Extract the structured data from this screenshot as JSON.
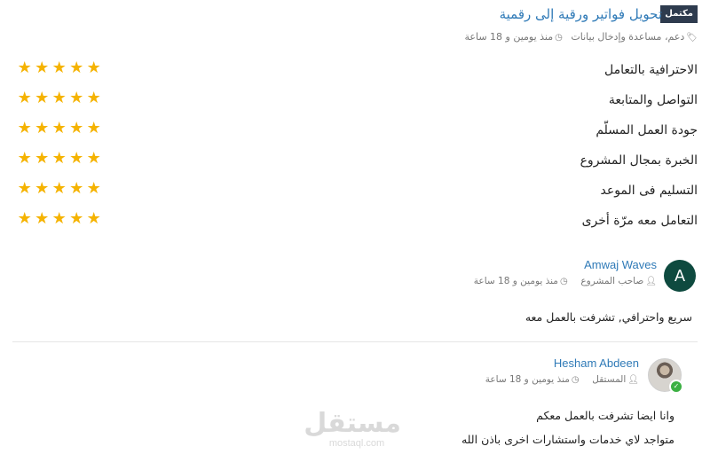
{
  "project": {
    "status_badge": "مكتمل",
    "title": "تحويل فواتير ورقية إلى رقمية",
    "tags": "دعم، مساعدة وإدخال بيانات",
    "time": "منذ يومين و 18 ساعة"
  },
  "ratings": [
    {
      "label": "الاحترافية بالتعامل",
      "stars": 5
    },
    {
      "label": "التواصل والمتابعة",
      "stars": 5
    },
    {
      "label": "جودة العمل المسلّم",
      "stars": 5
    },
    {
      "label": "الخبرة بمجال المشروع",
      "stars": 5
    },
    {
      "label": "التسليم فى الموعد",
      "stars": 5
    },
    {
      "label": "التعامل معه مرّة أخرى",
      "stars": 5
    }
  ],
  "reviews": [
    {
      "avatar_letter": "A",
      "name": "Amwaj Waves",
      "role": "صاحب المشروع",
      "time": "منذ يومين و 18 ساعة",
      "comment_lines": [
        "سريع واحترافي, تشرفت بالعمل معه"
      ]
    },
    {
      "name": "Hesham Abdeen",
      "role": "المستقل",
      "time": "منذ يومين و 18 ساعة",
      "comment_lines": [
        "وانا ايضا تشرفت بالعمل معكم",
        "متواجد لاي خدمات واستشارات اخرى باذن الله"
      ]
    }
  ],
  "watermark": {
    "arabic": "مستقل",
    "latin": "mostaql.com"
  },
  "colors": {
    "link": "#2f7ab7",
    "star": "#f5b301",
    "badge_bg": "#2e3b4e",
    "avatar_bg": "#0e4a3f",
    "online": "#3cb043"
  },
  "icons": [
    "tag-icon",
    "clock-icon",
    "user-icon",
    "star-icon",
    "check-icon"
  ]
}
